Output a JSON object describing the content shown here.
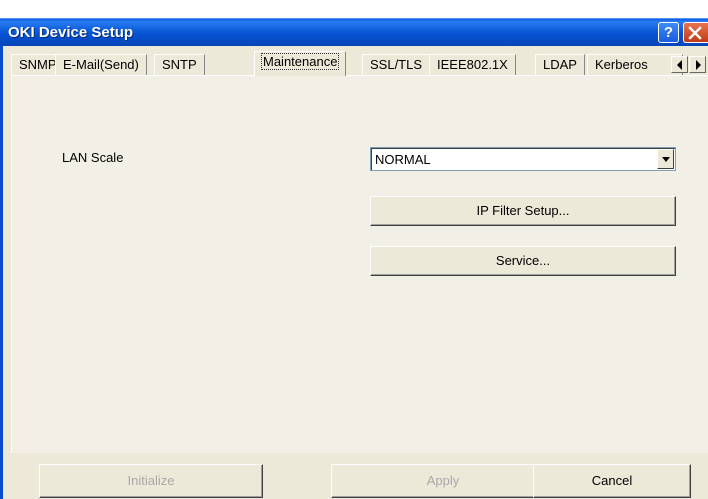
{
  "window": {
    "title": "OKI Device Setup",
    "help_glyph": "?"
  },
  "tabs": [
    {
      "label": "SNMP"
    },
    {
      "label": "E-Mail(Send)"
    },
    {
      "label": "SNTP"
    },
    {
      "label": "Maintenance",
      "active": true
    },
    {
      "label": "SSL/TLS"
    },
    {
      "label": "IEEE802.1X"
    },
    {
      "label": "LDAP"
    },
    {
      "label": "Kerberos"
    }
  ],
  "maintenance": {
    "lan_scale_label": "LAN Scale",
    "lan_scale_value": "NORMAL",
    "ip_filter_button": "IP Filter Setup...",
    "service_button": "Service..."
  },
  "footer": {
    "initialize_label": "Initialize",
    "apply_label": "Apply",
    "cancel_label": "Cancel"
  },
  "icons": {
    "help": "help-icon",
    "close": "close-icon",
    "scroll_left": "triangle-left-icon",
    "scroll_right": "triangle-right-icon",
    "dropdown": "triangle-down-icon"
  },
  "colors": {
    "titlebar": "#0b5ad8",
    "dialog_bg": "#ece9d8",
    "disabled_text": "#a8a8a8",
    "close_button": "#c13a14"
  }
}
